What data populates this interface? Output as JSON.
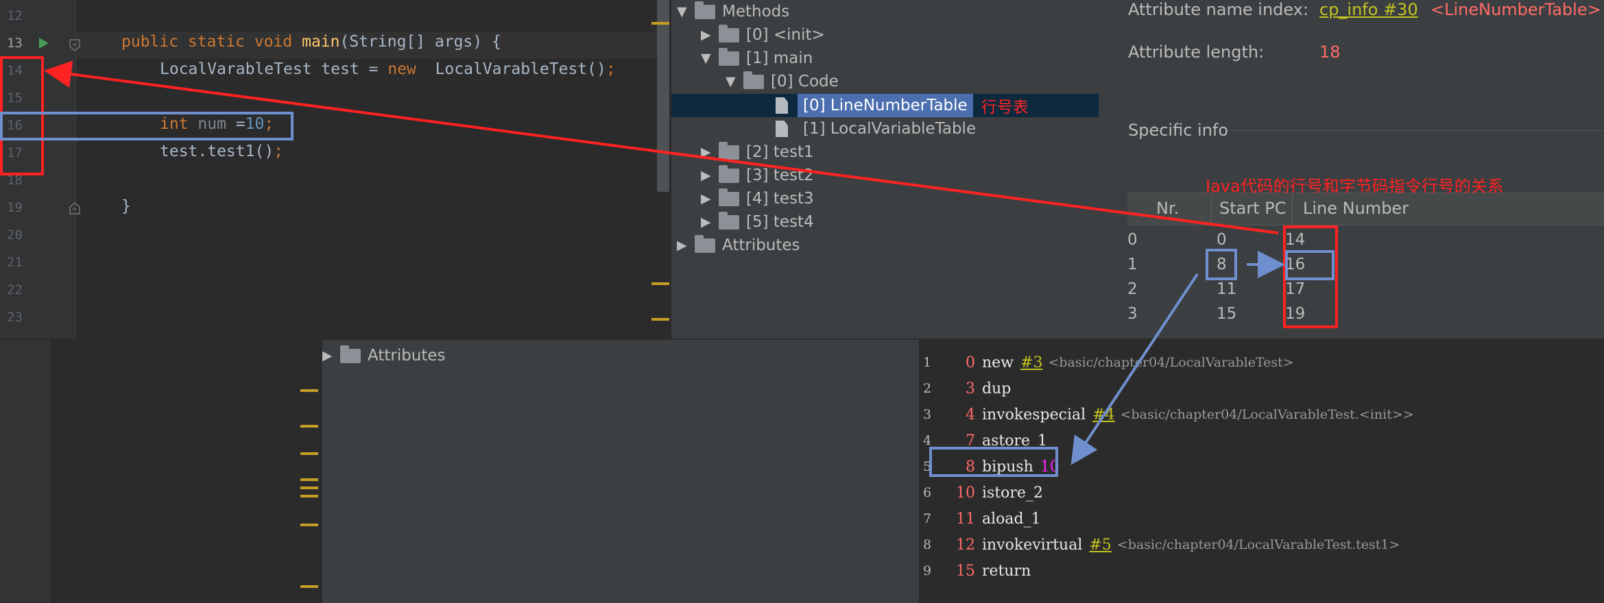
{
  "editor": {
    "line_numbers": [
      "12",
      "13",
      "14",
      "15",
      "16",
      "17",
      "18",
      "19",
      "20",
      "21",
      "22",
      "23"
    ],
    "code": {
      "l13_kw": "public static void ",
      "l13_fn": "main",
      "l13_rest": "(String[] args) {",
      "l14_type": "LocalVarableTest test = ",
      "l14_kw": "new",
      "l14_rest": "  LocalVarableTest()",
      "l14_semi": ";",
      "l16_kw": "int",
      "l16_var": " num ",
      "l16_eq": "=",
      "l16_num": "10",
      "l16_semi": ";",
      "l17": "test.test1()",
      "l17_semi": ";",
      "l19": "}"
    }
  },
  "tree": {
    "methods": "Methods",
    "init": "[0] <init>",
    "main": "[1] main",
    "code": "[0] Code",
    "lnt": "[0] LineNumberTable",
    "lnt_note": "行号表",
    "lvt": "[1] LocalVariableTable",
    "test1": "[2] test1",
    "test2": "[3] test2",
    "test3": "[4] test3",
    "test4": "[5] test4",
    "attributes": "Attributes"
  },
  "info": {
    "name_index_label": "Attribute name index:",
    "name_index_link": "cp_info #30",
    "name_index_value": "<LineNumberTable>",
    "length_label": "Attribute length:",
    "length_value": "18",
    "specific_info": "Specific info",
    "annotation": "Java代码的行号和字节码指令行号的关系",
    "columns": [
      "Nr.",
      "Start PC",
      "Line Number"
    ],
    "rows": [
      {
        "nr": "0",
        "pc": "0",
        "line": "14"
      },
      {
        "nr": "1",
        "pc": "8",
        "line": "16"
      },
      {
        "nr": "2",
        "pc": "11",
        "line": "17"
      },
      {
        "nr": "3",
        "pc": "15",
        "line": "19"
      }
    ]
  },
  "bottom_tree": {
    "attributes": "Attributes"
  },
  "bytecode": {
    "rows": [
      {
        "n": "1",
        "pc": "0",
        "op": "new",
        "ref": "#3",
        "cm": "<basic/chapter04/LocalVarableTest>"
      },
      {
        "n": "2",
        "pc": "3",
        "op": "dup"
      },
      {
        "n": "3",
        "pc": "4",
        "op": "invokespecial",
        "ref": "#4",
        "cm": "<basic/chapter04/LocalVarableTest.<init>>"
      },
      {
        "n": "4",
        "pc": "7",
        "op": "astore_1"
      },
      {
        "n": "5",
        "pc": "8",
        "op": "bipush",
        "arg": "10"
      },
      {
        "n": "6",
        "pc": "10",
        "op": "istore_2"
      },
      {
        "n": "7",
        "pc": "11",
        "op": "aload_1"
      },
      {
        "n": "8",
        "pc": "12",
        "op": "invokevirtual",
        "ref": "#5",
        "cm": "<basic/chapter04/LocalVarableTest.test1>"
      },
      {
        "n": "9",
        "pc": "15",
        "op": "return"
      }
    ]
  },
  "colors": {
    "annotation_red": "#ff2222",
    "annotation_blue": "#6f8fcf",
    "link_yellow": "#c3c322",
    "value_red": "#ff6b68"
  }
}
